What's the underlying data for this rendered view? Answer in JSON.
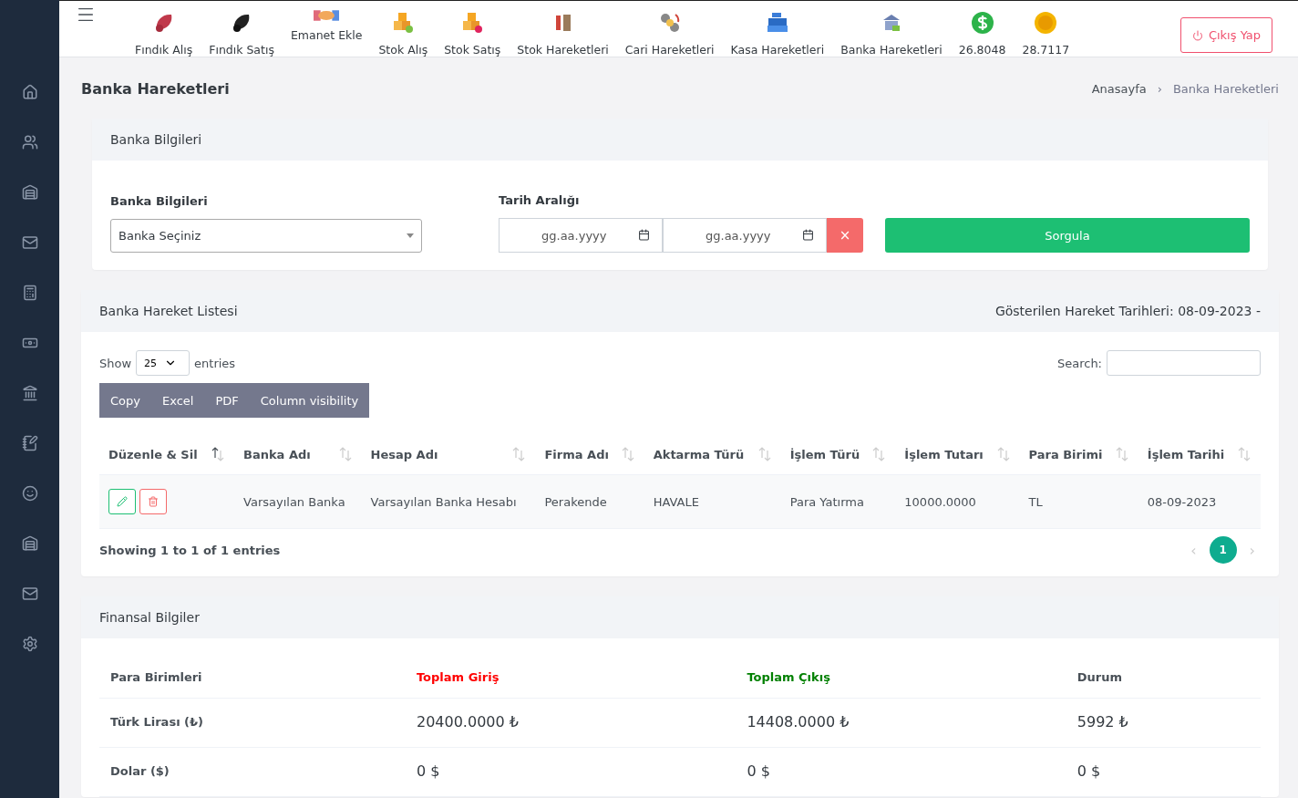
{
  "topbar": {
    "items": [
      {
        "label": "Fındık Alış"
      },
      {
        "label": "Fındık Satış"
      },
      {
        "label": "Emanet Ekle"
      },
      {
        "label": "Stok Alış"
      },
      {
        "label": "Stok Satış"
      },
      {
        "label": "Stok Hareketleri"
      },
      {
        "label": "Cari Hareketleri"
      },
      {
        "label": "Kasa Hareketleri"
      },
      {
        "label": "Banka Hareketleri"
      },
      {
        "label": "26.8048"
      },
      {
        "label": "28.7117"
      }
    ],
    "logout": "Çıkış Yap"
  },
  "page": {
    "title": "Banka Hareketleri",
    "breadcrumb": [
      "Anasayfa",
      "Banka Hareketleri"
    ],
    "breadcrumb_separator": "›"
  },
  "filter": {
    "header": "Banka Bilgileri",
    "bank_label": "Banka Bilgileri",
    "bank_value": "Banka Seçiniz",
    "date_label": "Tarih Aralığı",
    "date_from_placeholder": "gg.aa.yyyy",
    "date_to_placeholder": "gg.aa.yyyy",
    "clear": "×",
    "submit": "Sorgula"
  },
  "list": {
    "header": "Banka Hareket Listesi",
    "dates": "Gösterilen Hareket Tarihleri: 08-09-2023 -",
    "show": "Show",
    "page_size": "25",
    "entries": "entries",
    "search_label": "Search:",
    "buttons": [
      "Copy",
      "Excel",
      "PDF",
      "Column visibility"
    ],
    "columns": [
      {
        "label": "Düzenle & Sil",
        "sorted": true
      },
      {
        "label": "Banka Adı",
        "sorted": false
      },
      {
        "label": "Hesap Adı",
        "sorted": false
      },
      {
        "label": "Firma Adı",
        "sorted": false
      },
      {
        "label": "Aktarma Türü",
        "sorted": false
      },
      {
        "label": "İşlem Türü",
        "sorted": false
      },
      {
        "label": "İşlem Tutarı",
        "sorted": false
      },
      {
        "label": "Para Birimi",
        "sorted": false
      },
      {
        "label": "İşlem Tarihi",
        "sorted": false
      }
    ],
    "rows": [
      {
        "cells": [
          "",
          "Varsayılan Banka",
          "Varsayılan Banka Hesabı",
          "Perakende",
          "HAVALE",
          "Para Yatırma",
          "10000.0000",
          "TL",
          "08-09-2023"
        ]
      }
    ],
    "info": "Showing 1 to 1 of 1 entries",
    "pagination": {
      "prev": "‹",
      "next": "›",
      "pages": [
        {
          "label": "1",
          "selected": true
        }
      ]
    }
  },
  "finance": {
    "header": "Finansal Bilgiler",
    "columns": [
      {
        "label": "Para Birimleri",
        "color": "#495057"
      },
      {
        "label": "Toplam Giriş",
        "color": "#ff0000"
      },
      {
        "label": "Toplam Çıkış",
        "color": "#008000"
      },
      {
        "label": "Durum",
        "color": "#495057"
      }
    ],
    "rows": [
      {
        "name": "Türk Lirası (₺)",
        "values": [
          "20400.0000 ₺",
          "14408.0000 ₺",
          "5992 ₺"
        ]
      },
      {
        "name": "Dolar ($)",
        "values": [
          "0 $",
          "0 $",
          "0 $"
        ]
      }
    ]
  }
}
